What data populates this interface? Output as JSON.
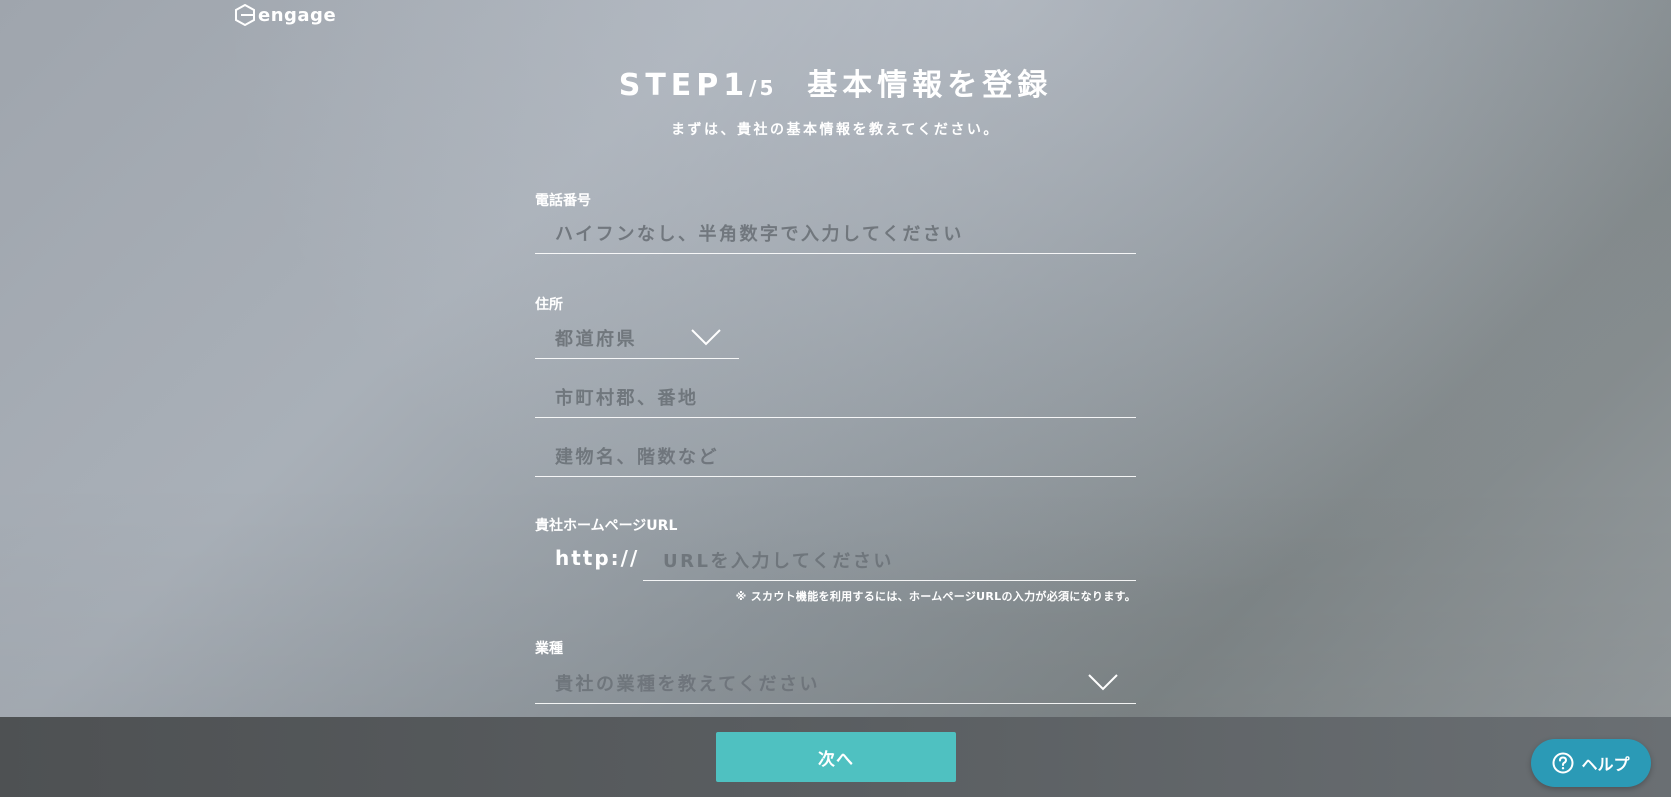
{
  "logo": {
    "text": "engage"
  },
  "header": {
    "step_main": "STEP1",
    "step_total": "/5",
    "title": "基本情報を登録",
    "subtitle": "まずは、貴社の基本情報を教えてください。"
  },
  "phone": {
    "label": "電話番号",
    "placeholder": "ハイフンなし、半角数字で入力してください"
  },
  "address": {
    "label": "住所",
    "prefecture_placeholder": "都道府県",
    "city_placeholder": "市町村郡、番地",
    "building_placeholder": "建物名、階数など"
  },
  "homepage": {
    "label": "貴社ホームページURL",
    "protocol": "http://",
    "placeholder": "URLを入力してください",
    "note": "※ スカウト機能を利用するには、ホームページURLの入力が必須になります。"
  },
  "industry": {
    "label": "業種",
    "placeholder": "貴社の業種を教えてください"
  },
  "footer": {
    "next_label": "次へ"
  },
  "help": {
    "label": "ヘルプ"
  },
  "colors": {
    "accent": "#4fc1c1",
    "help": "#2b9ab6",
    "footer": "#55595c"
  }
}
